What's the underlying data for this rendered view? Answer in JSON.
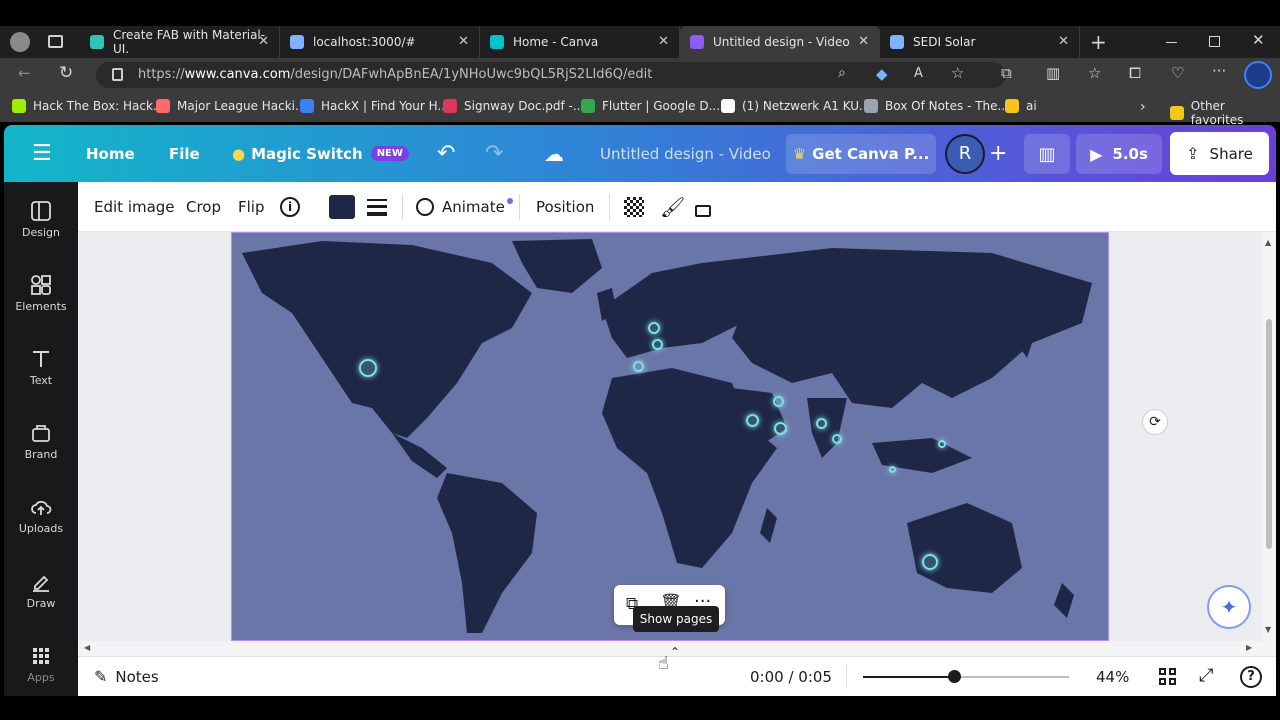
{
  "browser": {
    "tabs": [
      {
        "label": "Create FAB with Material-UI.",
        "color": "#2ec4b6"
      },
      {
        "label": "localhost:3000/#",
        "color": "#7fb3ff"
      },
      {
        "label": "Home - Canva",
        "color": "#00c4cc"
      },
      {
        "label": "Untitled design - Video",
        "color": "#8b5cf6"
      },
      {
        "label": "SEDI Solar",
        "color": "#7fb3ff"
      }
    ],
    "url_prefix": "https://",
    "url_host": "www.canva.com",
    "url_path": "/design/DAFwhApBnEA/1yNHoUwc9bQL5RjS2LId6Q/edit",
    "bookmarks": [
      {
        "label": "Hack The Box: Hack...",
        "color": "#9fef00"
      },
      {
        "label": "Major League Hacki...",
        "color": "#ff6b6b"
      },
      {
        "label": "HackX | Find Your H...",
        "color": "#3b82f6"
      },
      {
        "label": "Signway Doc.pdf -...",
        "color": "#e0355d"
      },
      {
        "label": "Flutter | Google D...",
        "color": "#34a853"
      },
      {
        "label": "(1) Netzwerk A1 KU...",
        "color": "#ffffff"
      },
      {
        "label": "Box Of Notes - The...",
        "color": "#9ca3af"
      },
      {
        "label": "ai",
        "color": "#f5c518"
      }
    ],
    "other_favorites": "Other favorites"
  },
  "header": {
    "home": "Home",
    "file": "File",
    "magic_switch": "Magic Switch",
    "new_badge": "NEW",
    "design_title": "Untitled design - Video",
    "get_pro": "Get Canva P...",
    "avatar_initial": "R",
    "play_duration": "5.0s",
    "share": "Share"
  },
  "rail": [
    {
      "label": "Design",
      "icon": "layout-icon"
    },
    {
      "label": "Elements",
      "icon": "shapes-icon"
    },
    {
      "label": "Text",
      "icon": "text-icon"
    },
    {
      "label": "Brand",
      "icon": "brand-icon"
    },
    {
      "label": "Uploads",
      "icon": "upload-cloud-icon"
    },
    {
      "label": "Draw",
      "icon": "pen-icon"
    },
    {
      "label": "Apps",
      "icon": "grid-icon"
    }
  ],
  "toolbar": {
    "edit_image": "Edit image",
    "crop": "Crop",
    "flip": "Flip",
    "animate": "Animate",
    "position": "Position",
    "swatch_color": "#1f2747"
  },
  "canvas": {
    "tooltip": "Show pages"
  },
  "footer": {
    "notes": "Notes",
    "timecode": "0:00 / 0:05",
    "zoom": "44%",
    "zoom_level": 0.44
  },
  "colors": {
    "map_ocean": "#6b76a8",
    "map_land": "#1f2747",
    "hotspot": "#7de0e6"
  }
}
